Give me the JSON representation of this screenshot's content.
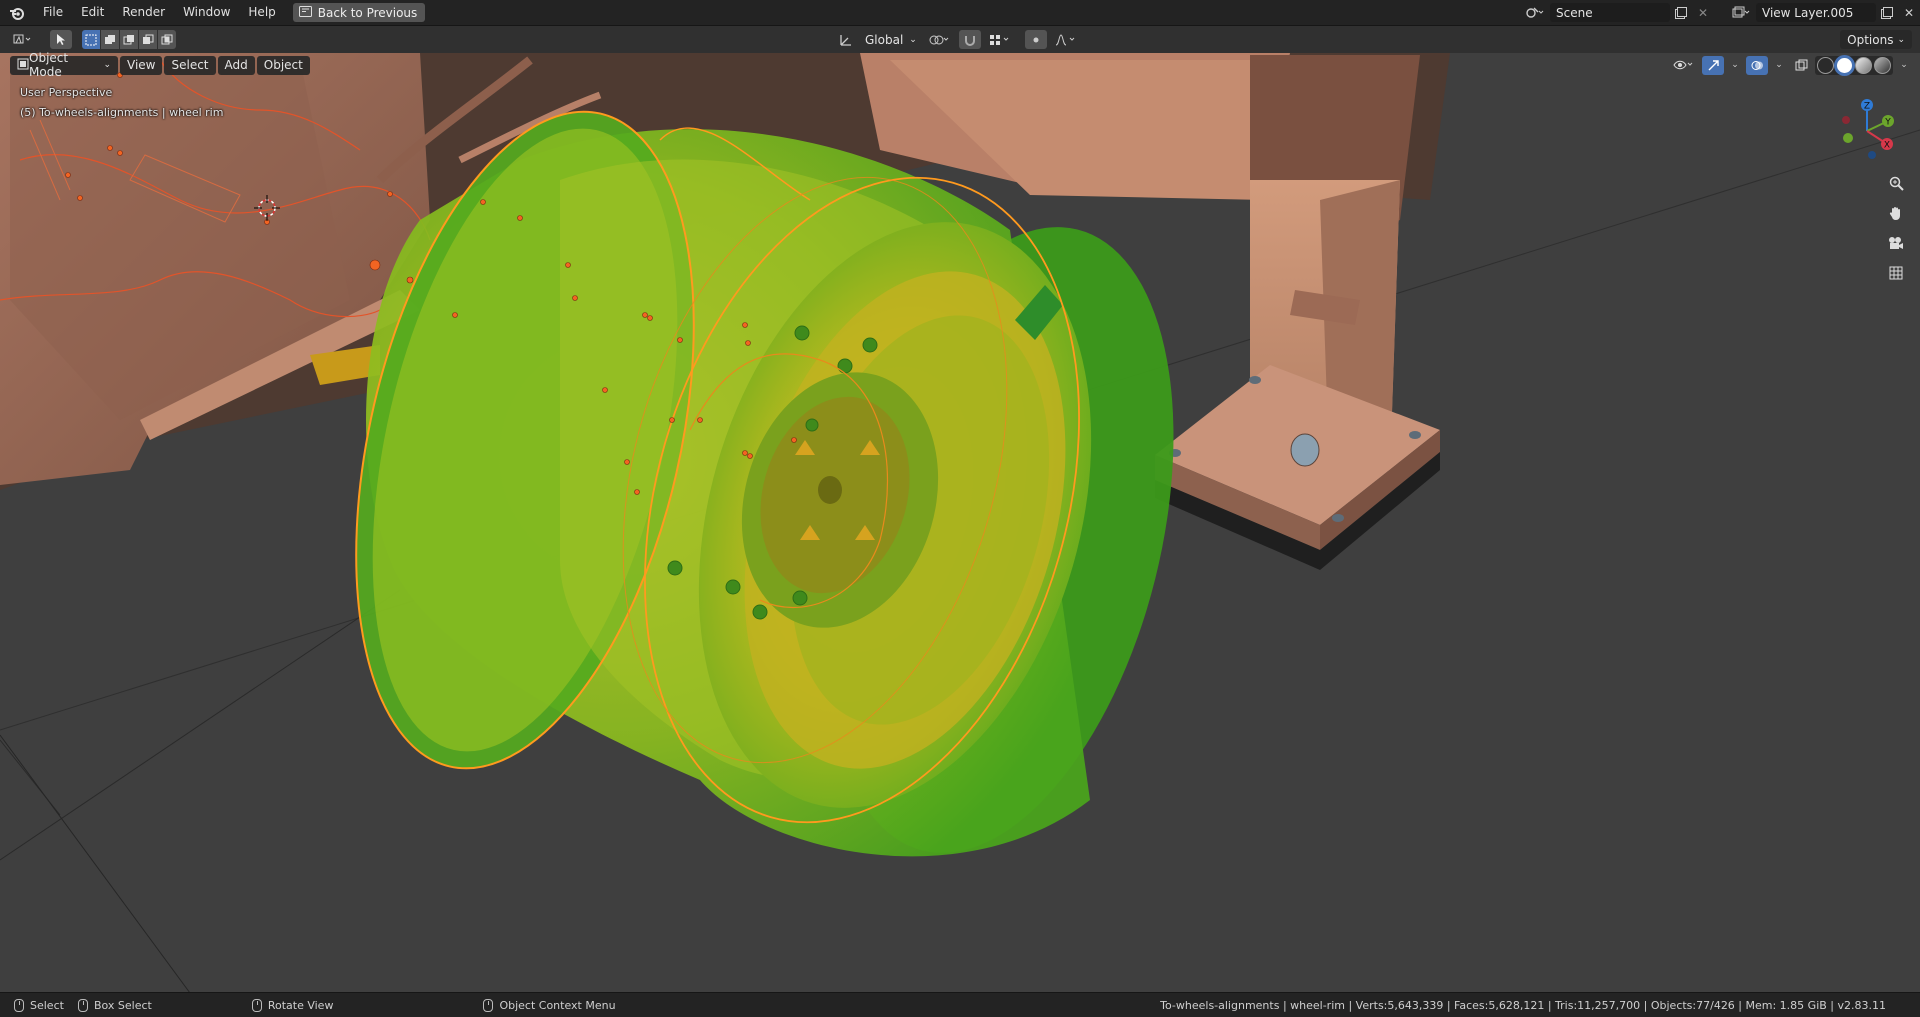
{
  "menu": {
    "items": [
      "File",
      "Edit",
      "Render",
      "Window",
      "Help"
    ],
    "back_button": "Back to Previous"
  },
  "scene": {
    "name": "Scene"
  },
  "view_layer": {
    "name": "View Layer.005"
  },
  "header": {
    "transform_orientation": "Global",
    "options_label": "Options"
  },
  "viewport_header": {
    "mode": "Object Mode",
    "view": "View",
    "select": "Select",
    "add": "Add",
    "object": "Object"
  },
  "overlay": {
    "perspective": "User Perspective",
    "active_object": "(5) To-wheels-alignments | wheel rim"
  },
  "gizmo": {
    "x": "X",
    "y": "Y",
    "z": "Z"
  },
  "statusbar": {
    "select": "Select",
    "box_select": "Box Select",
    "rotate_view": "Rotate View",
    "context_menu": "Object Context Menu",
    "stats": "To-wheels-alignments | wheel-rim | Verts:5,643,339 | Faces:5,628,121 | Tris:11,257,700 | Objects:77/426 | Mem: 1.85 GiB | v2.83.11"
  },
  "colors": {
    "rim_green": "#4fae1c",
    "rim_yellow": "#a6c21a",
    "selection_outline": "#ff9a1e",
    "body_copper": "#c58a6e",
    "viewport_bg": "#3f3f3f"
  },
  "icons": [
    "blender-icon",
    "back-icon",
    "scene-icon",
    "view-layer-icon",
    "zoom-icon",
    "hand-icon",
    "camera-icon",
    "grid-icon",
    "cursor-icon"
  ]
}
